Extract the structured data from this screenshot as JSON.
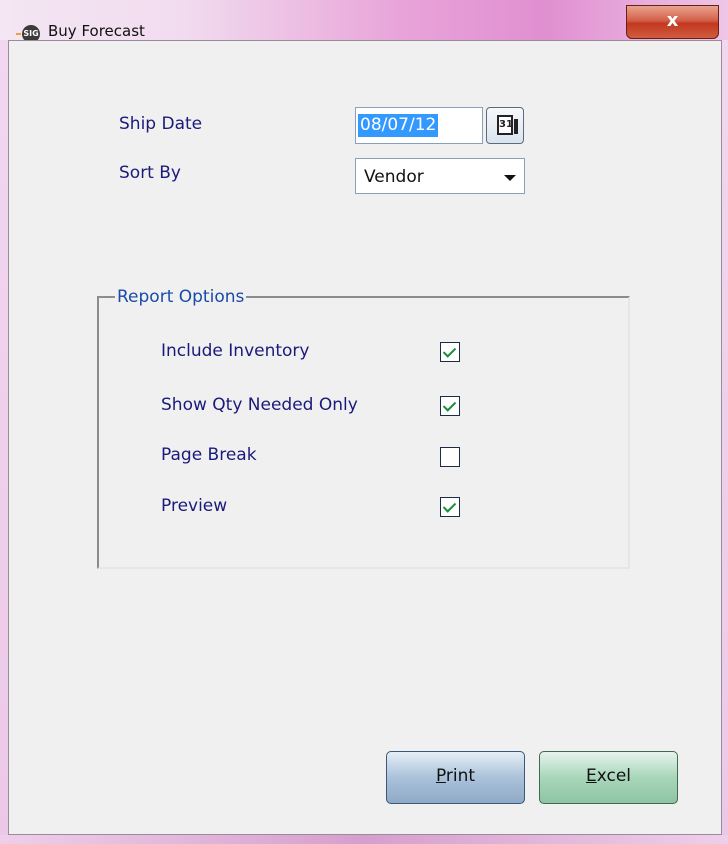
{
  "window": {
    "title": "Buy Forecast",
    "app_icon_text": "SIG",
    "close_glyph": "x"
  },
  "form": {
    "ship_date_label": "Ship Date",
    "ship_date_value": "08/07/12",
    "calendar_icon_text": "31",
    "sort_by_label": "Sort By",
    "sort_by_value": "Vendor"
  },
  "report_options": {
    "legend": "Report Options",
    "options": [
      {
        "label": "Include Inventory",
        "checked": true
      },
      {
        "label": "Show Qty Needed Only",
        "checked": true
      },
      {
        "label": "Page Break",
        "checked": false
      },
      {
        "label": "Preview",
        "checked": true
      }
    ]
  },
  "buttons": {
    "print_mnemonic": "P",
    "print_rest": "rint",
    "excel_mnemonic": "E",
    "excel_rest": "xcel"
  },
  "colors": {
    "label_text": "#1a1a7a",
    "legend_text": "#1a4aa8",
    "check_mark": "#1a8c3a",
    "selection": "#3399ff"
  }
}
